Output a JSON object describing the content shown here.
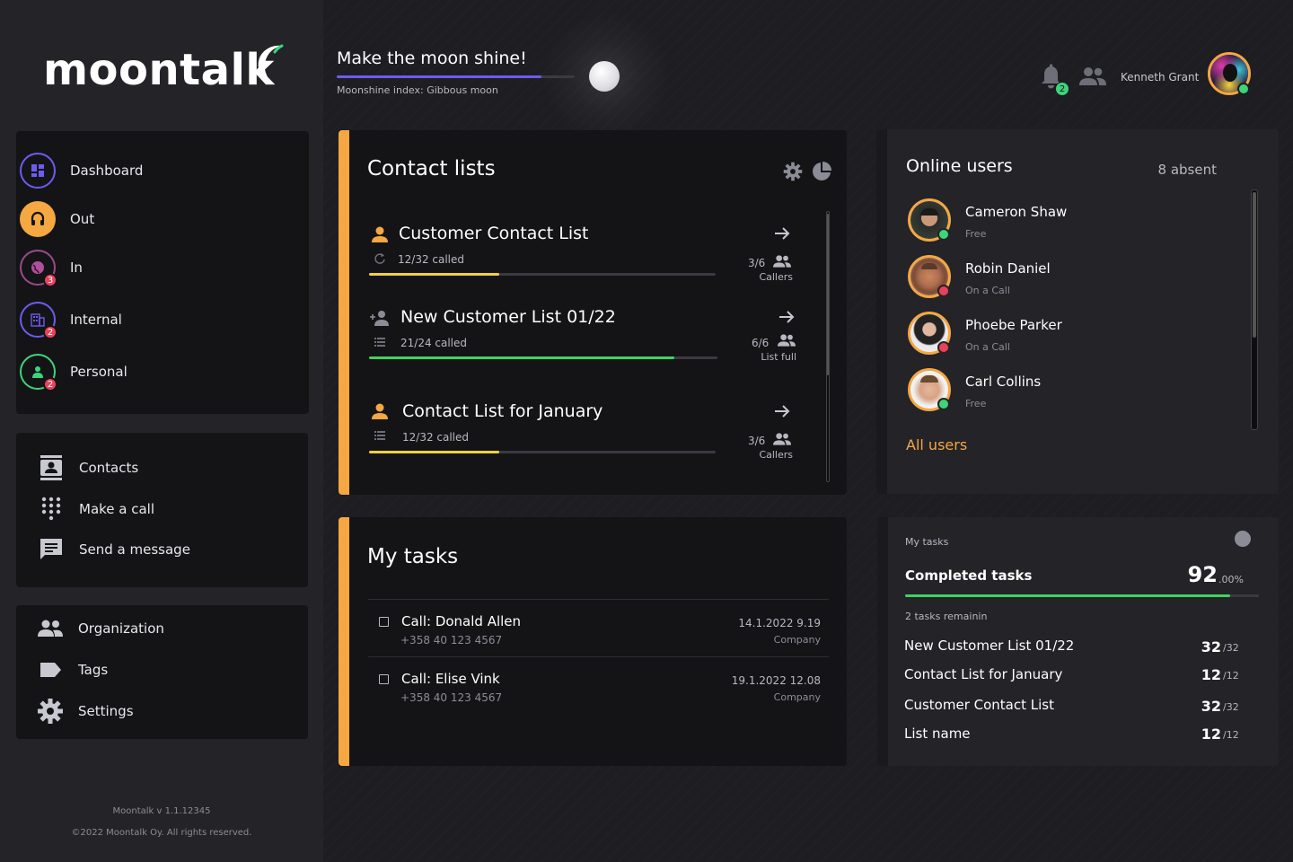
{
  "brand": {
    "name": "moontalk"
  },
  "header": {
    "title": "Make the moon shine!",
    "moonshine_index": "Moonshine index: Gibbous moon",
    "moonshine_progress": 0.86,
    "notification_count": "2",
    "user_name": "Kenneth Grant"
  },
  "nav": {
    "items": [
      {
        "label": "Dashboard",
        "icon": "dashboard-icon",
        "badge": ""
      },
      {
        "label": "Out",
        "icon": "headset-icon",
        "badge": ""
      },
      {
        "label": "In",
        "icon": "globe-icon",
        "badge": "3"
      },
      {
        "label": "Internal",
        "icon": "building-icon",
        "badge": "2"
      },
      {
        "label": "Personal",
        "icon": "person-icon",
        "badge": "2"
      }
    ]
  },
  "links": {
    "items": [
      {
        "label": "Contacts",
        "icon": "contacts-icon"
      },
      {
        "label": "Make a call",
        "icon": "dialpad-icon"
      },
      {
        "label": "Send a message",
        "icon": "message-icon"
      }
    ]
  },
  "admin": {
    "items": [
      {
        "label": "Organization",
        "icon": "group-icon"
      },
      {
        "label": "Tags",
        "icon": "tag-icon"
      },
      {
        "label": "Settings",
        "icon": "gear-icon"
      }
    ]
  },
  "footer": {
    "version": "Moontalk v 1.1.12345",
    "copyright": "©2022 Moontalk Oy. All rights reserved."
  },
  "contact_lists": {
    "title": "Contact lists",
    "items": [
      {
        "name": "Customer Contact List",
        "called": "12/32 called",
        "progress": 0.375,
        "bar_color": "#f2d13a",
        "count": "3/6",
        "caption": "Callers"
      },
      {
        "name": "New Customer List 01/22",
        "called": "21/24 called",
        "progress": 0.875,
        "bar_color": "#3ed45f",
        "count": "6/6",
        "caption": "List full"
      },
      {
        "name": "Contact List for January",
        "called": "12/32 called",
        "progress": 0.375,
        "bar_color": "#f2d13a",
        "count": "3/6",
        "caption": "Callers"
      }
    ]
  },
  "my_tasks": {
    "title": "My tasks",
    "items": [
      {
        "name": "Call: Donald Allen",
        "phone": "+358 40 123 4567",
        "date": "14.1.2022 9.19",
        "type": "Company"
      },
      {
        "name": "Call: Elise Vink",
        "phone": "+358 40 123 4567",
        "date": "19.1.2022 12.08",
        "type": "Company"
      }
    ]
  },
  "online_users": {
    "title": "Online users",
    "absent": "8 absent",
    "all_users_link": "All users",
    "users": [
      {
        "name": "Cameron Shaw",
        "status": "Free",
        "status_color": "#3ed47a"
      },
      {
        "name": "Robin Daniel",
        "status": "On a Call",
        "status_color": "#e8425a"
      },
      {
        "name": "Phoebe Parker",
        "status": "On a Call",
        "status_color": "#e8425a"
      },
      {
        "name": "Carl Collins",
        "status": "Free",
        "status_color": "#3ed47a"
      }
    ]
  },
  "task_summary": {
    "heading": "My tasks",
    "label": "Completed tasks",
    "value": "92",
    "decimal": ".00%",
    "progress": 0.92,
    "remaining": "2 tasks remainin",
    "rows": [
      {
        "name": "New Customer List 01/22",
        "done": "32",
        "total": "/32"
      },
      {
        "name": "Contact List for January",
        "done": "12",
        "total": "/12"
      },
      {
        "name": "Customer Contact List",
        "done": "32",
        "total": "/32"
      },
      {
        "name": "List name",
        "done": "12",
        "total": "/12"
      }
    ]
  },
  "colors": {
    "accent": "#f5a742",
    "purple": "#6c5cf0",
    "green": "#3ed45f",
    "yellow": "#f2d13a",
    "red": "#e8425a"
  }
}
